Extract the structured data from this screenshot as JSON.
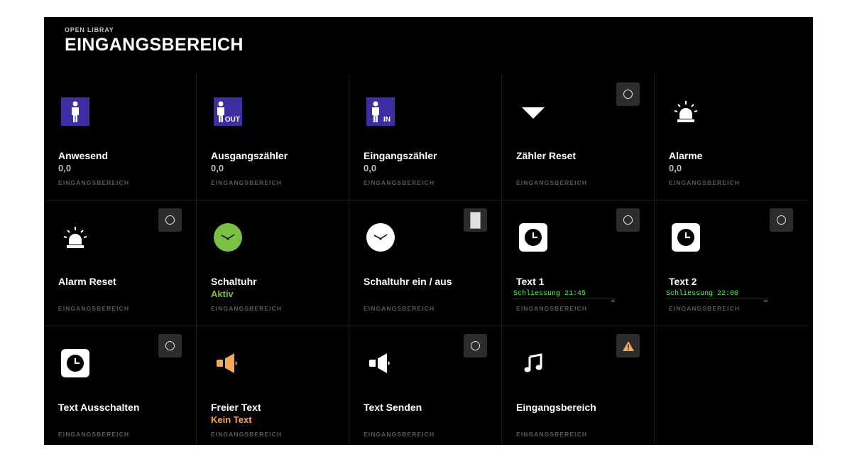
{
  "header": {
    "overline": "OPEN LIBRAY",
    "title": "EINGANGSBEREICH"
  },
  "tiles": [
    {
      "label": "Anwesend",
      "value": "0,0",
      "category": "EINGANGSBEREICH",
      "icon": "person-icon"
    },
    {
      "label": "Ausgangszähler",
      "value": "0,0",
      "category": "EINGANGSBEREICH",
      "icon": "person-out-icon",
      "icon_tag": "OUT"
    },
    {
      "label": "Eingangszähler",
      "value": "0,0",
      "category": "EINGANGSBEREICH",
      "icon": "person-in-icon",
      "icon_tag": "IN"
    },
    {
      "label": "Zähler Reset",
      "value": "",
      "category": "EINGANGSBEREICH",
      "icon": "triangle-down-icon",
      "control": "ring"
    },
    {
      "label": "Alarme",
      "value": "0,0",
      "category": "EINGANGSBEREICH",
      "icon": "siren-icon"
    },
    {
      "label": "Alarm Reset",
      "value": "",
      "category": "EINGANGSBEREICH",
      "icon": "siren-icon",
      "control": "ring"
    },
    {
      "label": "Schaltuhr",
      "value": "Aktiv",
      "category": "EINGANGSBEREICH",
      "icon": "clock-green-icon"
    },
    {
      "label": "Schaltuhr ein / aus",
      "value": "",
      "category": "EINGANGSBEREICH",
      "icon": "clock-white-icon",
      "control": "toggle"
    },
    {
      "label": "Text 1",
      "value": "Schliessung 21:45",
      "category": "EINGANGSBEREICH",
      "icon": "clock-square-icon",
      "control": "ring"
    },
    {
      "label": "Text 2",
      "value": "Schliessung 22:00",
      "category": "EINGANGSBEREICH",
      "icon": "clock-square-icon",
      "control": "ring"
    },
    {
      "label": "Text Ausschalten",
      "value": "",
      "category": "EINGANGSBEREICH",
      "icon": "clock-square-icon",
      "control": "ring"
    },
    {
      "label": "Freier Text",
      "value": "Kein Text",
      "category": "EINGANGSBEREICH",
      "icon": "megaphone-icon"
    },
    {
      "label": "Text Senden",
      "value": "",
      "category": "EINGANGSBEREICH",
      "icon": "megaphone-icon",
      "control": "ring"
    },
    {
      "label": "Eingangsbereich",
      "value": "",
      "category": "EINGANGSBEREICH",
      "icon": "music-note-icon",
      "control": "warning"
    }
  ],
  "colors": {
    "green": "#7ac143",
    "orange": "#f4a957",
    "indigo": "#3d2fa3",
    "warning": "#f4a957",
    "mono_text": "#39ff39"
  }
}
